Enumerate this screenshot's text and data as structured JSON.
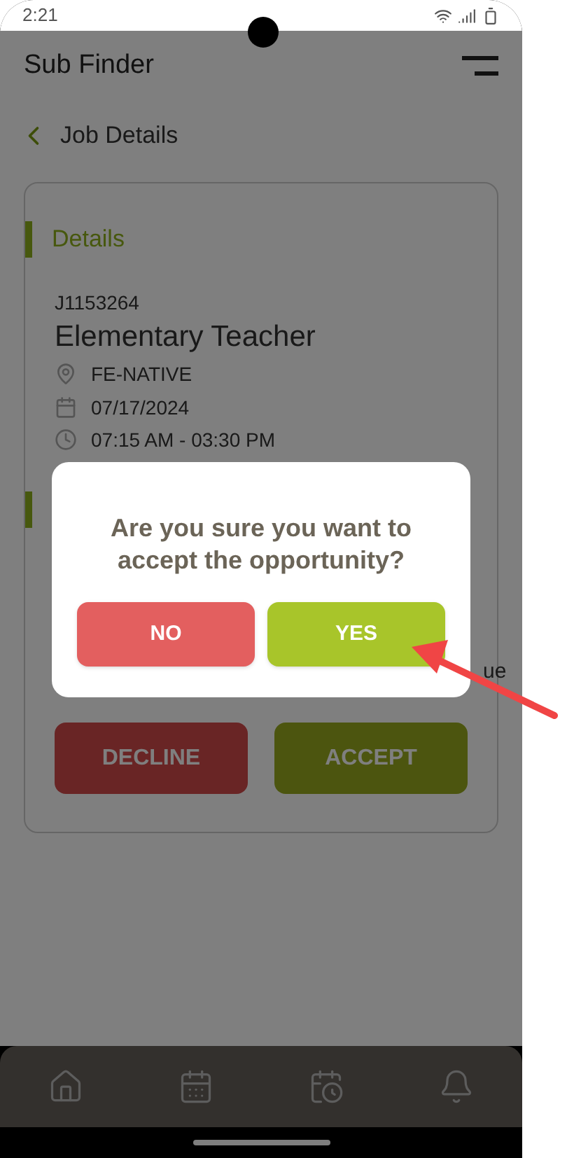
{
  "status_bar": {
    "time": "2:21"
  },
  "app_title": "Sub Finder",
  "page_title": "Job Details",
  "details": {
    "heading": "Details",
    "job_id": "J1153264",
    "title": "Elementary Teacher",
    "location": "FE-NATIVE",
    "date": "07/17/2024",
    "time": "07:15 AM - 03:30 PM"
  },
  "hidden_fragment": "ue",
  "actions": [
    {
      "label": "DECLINE",
      "kind": "decline"
    },
    {
      "label": "ACCEPT",
      "kind": "accept"
    }
  ],
  "dialog": {
    "message": "Are you sure you want to accept the opportunity?",
    "buttons": [
      {
        "label": "NO",
        "kind": "no"
      },
      {
        "label": "YES",
        "kind": "yes"
      }
    ]
  },
  "bottom_nav": [
    {
      "kind": "home"
    },
    {
      "kind": "calendar"
    },
    {
      "kind": "schedule"
    },
    {
      "kind": "bell"
    }
  ]
}
